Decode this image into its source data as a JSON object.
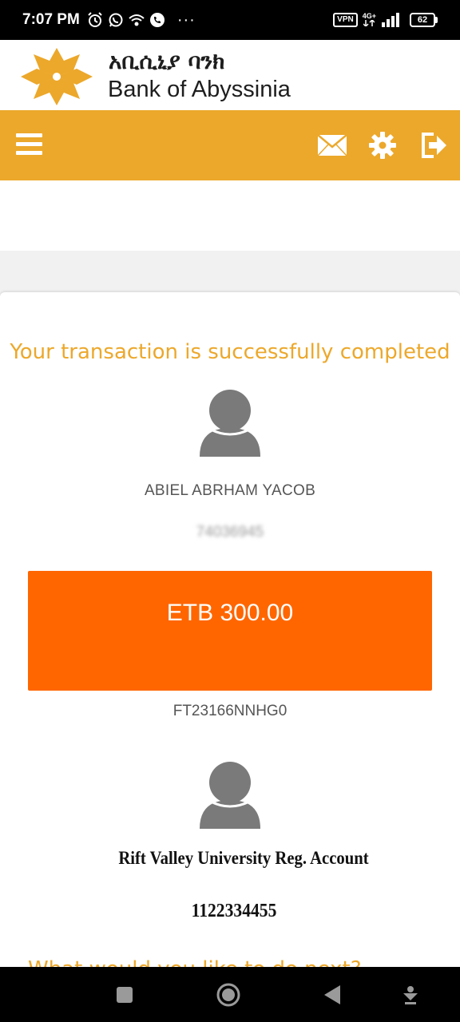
{
  "status_bar": {
    "time": "7:07 PM",
    "icons": [
      "alarm-icon",
      "whatsapp-icon",
      "wifi-call-icon",
      "phone-icon"
    ],
    "more": "···",
    "vpn": "VPN",
    "network": "4G+",
    "battery": "62"
  },
  "brand": {
    "name_amharic": "አቢሲኒያ ባንክ",
    "name_english": "Bank of Abyssinia",
    "logo": "star-logo-icon"
  },
  "toolbar": {
    "menu_icon": "hamburger-menu-icon",
    "mail_icon": "mail-icon",
    "settings_icon": "gear-icon",
    "logout_icon": "logout-icon"
  },
  "transaction": {
    "success_message": "Your transaction is successfully completed",
    "sender_name": "ABIEL ABRHAM YACOB",
    "sender_account": "74036945",
    "amount": "ETB  300.00",
    "reference": "FT23166NNHG0",
    "receiver_name": "Rift Valley University Reg. Account",
    "receiver_account": "1122334455",
    "next_question": "What would you like to do next?"
  },
  "nav_bar": {
    "recents_icon": "square-recents-icon",
    "home_icon": "circle-home-icon",
    "back_icon": "triangle-back-icon",
    "assist_icon": "download-assist-icon"
  },
  "colors": {
    "brand_gold": "#eca82b",
    "amount_orange": "#ff6600",
    "avatar_grey": "#7a7a7a"
  }
}
